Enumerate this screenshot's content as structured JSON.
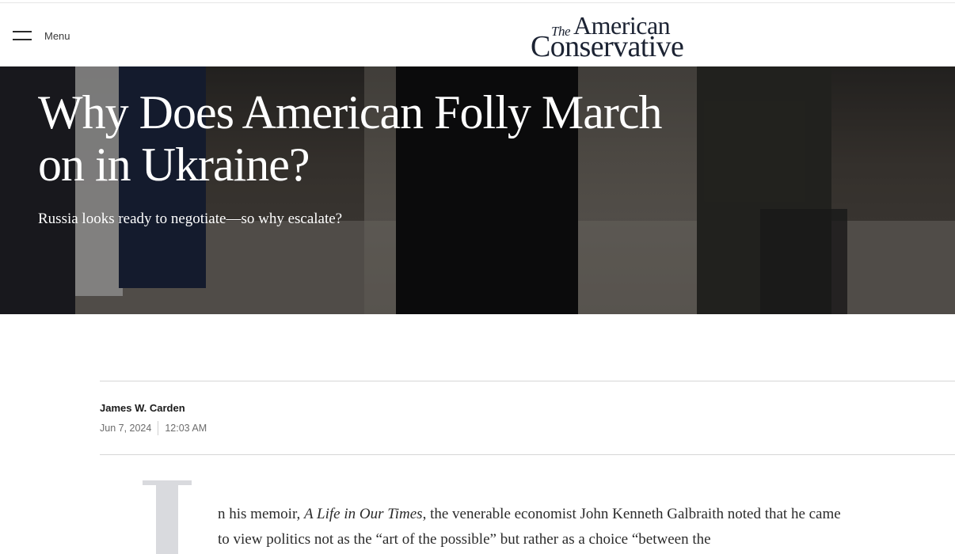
{
  "header": {
    "menu_label": "Menu",
    "logo": {
      "the": "The",
      "american": "American",
      "conservative": "Conservative"
    }
  },
  "hero": {
    "title": "Why Does American Folly March on in Ukraine?",
    "dek": "Russia looks ready to negotiate—so why escalate?"
  },
  "meta": {
    "author": "James W. Carden",
    "date": "Jun 7, 2024",
    "time": "12:03 AM"
  },
  "body": {
    "dropcap": "I",
    "p1_part1": "n his memoir, ",
    "p1_book": "A Life in Our Times",
    "p1_part2": ", the venerable economist John Kenneth Galbraith noted that he came to view politics not as the “art of the possible” but rather as a choice “between the"
  },
  "colors": {
    "logo": "#1c2333",
    "text": "#2b2b2b",
    "meta_gray": "#6c6c6c",
    "rule": "#d6d6d6",
    "dropcap": "#d9dade"
  }
}
